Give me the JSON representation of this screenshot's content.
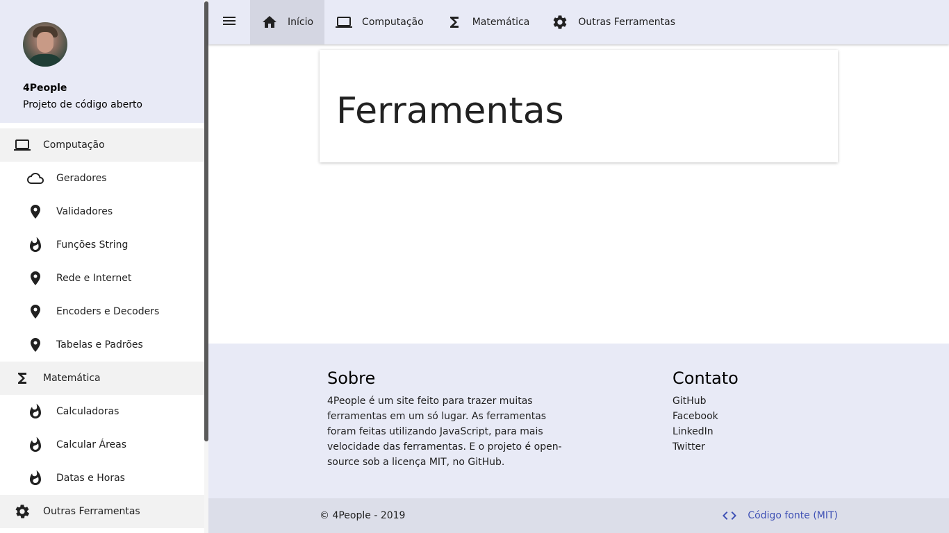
{
  "sidebar": {
    "brand": "4People",
    "tagline": "Projeto de código aberto",
    "groups": [
      {
        "label": "Computação",
        "icon": "laptop-icon",
        "items": [
          {
            "label": "Geradores",
            "icon": "cloud-icon"
          },
          {
            "label": "Validadores",
            "icon": "place-icon"
          },
          {
            "label": "Funções String",
            "icon": "fire-icon"
          },
          {
            "label": "Rede e Internet",
            "icon": "place-icon"
          },
          {
            "label": "Encoders e Decoders",
            "icon": "place-icon"
          },
          {
            "label": "Tabelas e Padrões",
            "icon": "place-icon"
          }
        ]
      },
      {
        "label": "Matemática",
        "icon": "sigma-icon",
        "items": [
          {
            "label": "Calculadoras",
            "icon": "fire-icon"
          },
          {
            "label": "Calcular Áreas",
            "icon": "fire-icon"
          },
          {
            "label": "Datas e Horas",
            "icon": "fire-icon"
          }
        ]
      },
      {
        "label": "Outras Ferramentas",
        "icon": "gear-icon",
        "items": []
      }
    ]
  },
  "topbar": {
    "menu_icon": "menu-icon",
    "tabs": [
      {
        "label": "Início",
        "icon": "home-icon",
        "active": true
      },
      {
        "label": "Computação",
        "icon": "laptop-icon",
        "active": false
      },
      {
        "label": "Matemática",
        "icon": "sigma-icon",
        "active": false
      },
      {
        "label": "Outras Ferramentas",
        "icon": "gear-icon",
        "active": false
      }
    ]
  },
  "main": {
    "title": "Ferramentas"
  },
  "footer": {
    "about_title": "Sobre",
    "about_text": "4People é um site feito para trazer muitas ferramentas em um só lugar. As ferramentas foram feitas utilizando JavaScript, para mais velocidade das ferramentas. E o projeto é open-source sob a licença MIT, no GitHub.",
    "contact_title": "Contato",
    "contact_links": [
      "GitHub",
      "Facebook",
      "LinkedIn",
      "Twitter"
    ],
    "copyright": "© 4People - 2019",
    "source_label": "Código fonte (MIT)",
    "source_icon": "code-icon"
  },
  "colors": {
    "header_bg": "#e8eaf6",
    "accent_link": "#3f51b5",
    "group_bg": "#f2f2f2"
  }
}
